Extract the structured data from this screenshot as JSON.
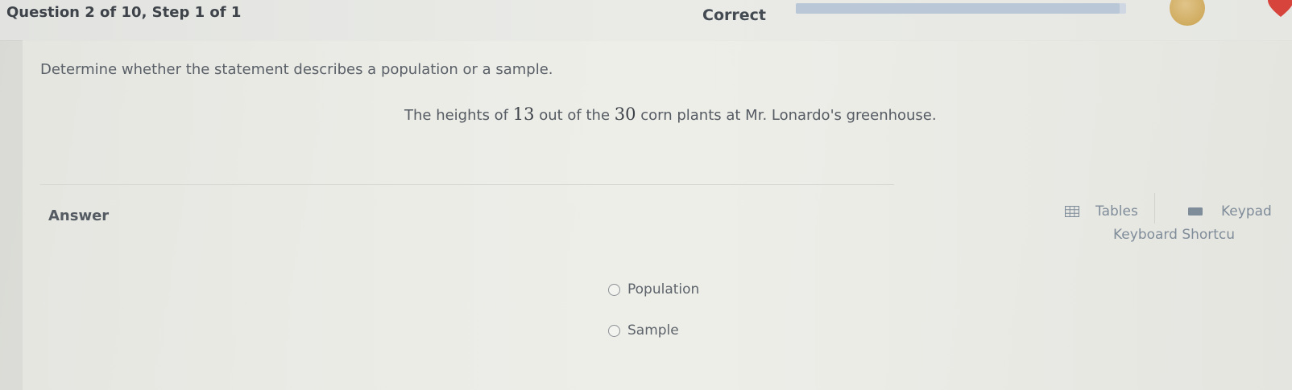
{
  "header": {
    "question_step": "Question 2 of 10, Step 1 of 1",
    "status": "Correct",
    "progress_fraction": 0.98
  },
  "question": {
    "instruction": "Determine whether the statement describes a population or a sample.",
    "statement_prefix": "The heights of ",
    "statement_num1": "13",
    "statement_middle": " out of the ",
    "statement_num2": "30",
    "statement_suffix": " corn plants at Mr. Lonardo's greenhouse."
  },
  "answer": {
    "label": "Answer",
    "tools": {
      "tables_label": "Tables",
      "keypad_label": "Keypad",
      "shortcuts_label": "Keyboard Shortcu"
    },
    "options": [
      {
        "label": "Population",
        "selected": false
      },
      {
        "label": "Sample",
        "selected": false
      }
    ]
  },
  "colors": {
    "link": "#7f8c99",
    "heart": "#d6443c",
    "avatar": "#d2b06a"
  }
}
